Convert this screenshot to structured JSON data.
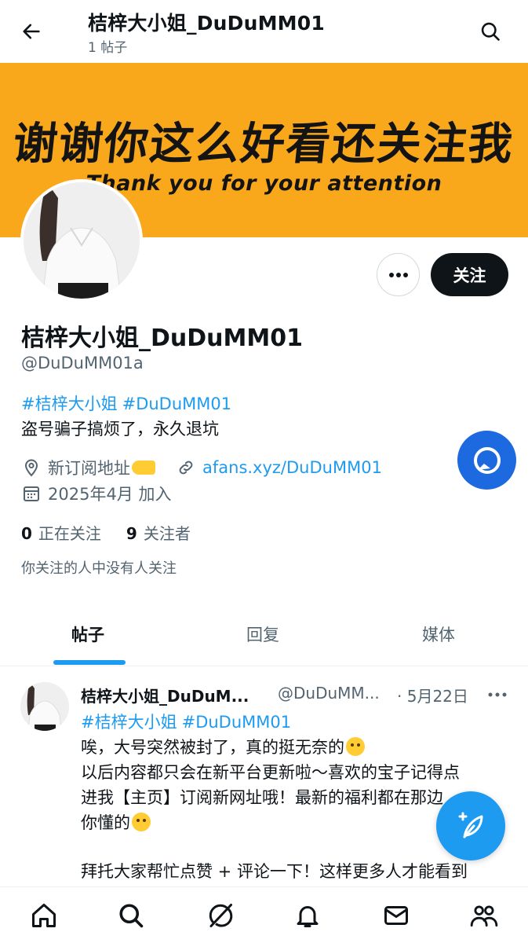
{
  "header": {
    "title": "桔梓大小姐_DuDuMM01",
    "post_count_label": "1 帖子"
  },
  "banner": {
    "headline_cn": "谢谢你这么好看还关注我",
    "headline_en": "Thank you for your attention",
    "background_color": "#f9a81b"
  },
  "profile": {
    "display_name": "桔梓大小姐_DuDuMM01",
    "handle": "@DuDuMM01a",
    "bio_hashtags": [
      "#桔梓大小姐",
      "#DuDuMM01"
    ],
    "bio_text": "盗号骗子搞烦了，永久退坑",
    "location": "新订阅地址",
    "website": "afans.xyz/DuDuMM01",
    "joined": "2025年4月 加入",
    "following_count": "0",
    "following_label": "正在关注",
    "followers_count": "9",
    "followers_label": "关注者",
    "mutual_note": "你关注的人中没有人关注",
    "follow_button_label": "关注"
  },
  "tabs": [
    {
      "label": "帖子",
      "active": true
    },
    {
      "label": "回复",
      "active": false
    },
    {
      "label": "媒体",
      "active": false
    }
  ],
  "post": {
    "author_name": "桔梓大小姐_DuDuM...",
    "author_handle": "@DuDuMM...",
    "date": "· 5月22日",
    "hashtags": [
      "#桔梓大小姐",
      "#DuDuMM01"
    ],
    "lines": [
      "唉，大号突然被封了，真的挺无奈的",
      "以后内容都只会在新平台更新啦～喜欢的宝子记得点",
      "进我【主页】订阅新网址哦！最新的福利都在那边",
      "你懂的",
      "拜托大家帮忙点赞 + 评论一下！这样更多人才能看到"
    ]
  },
  "bottom_nav": [
    "home-icon",
    "search-icon",
    "grok-icon",
    "notifications-icon",
    "messages-icon",
    "communities-icon"
  ],
  "colors": {
    "accent": "#1d9bf0",
    "text_primary": "#0f1419",
    "text_secondary": "#536471"
  }
}
